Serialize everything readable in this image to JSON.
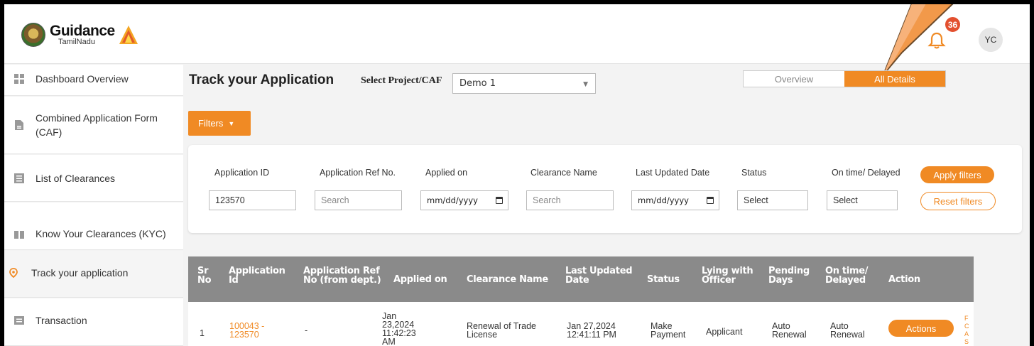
{
  "header": {
    "logo_title": "Guidance",
    "logo_subtitle": "TamilNadu",
    "notification_count": "36",
    "avatar_initials": "YC"
  },
  "sidebar": {
    "items": [
      {
        "label": "Dashboard Overview",
        "icon": "dashboard-icon"
      },
      {
        "label": "Combined Application Form (CAF)",
        "icon": "document-icon"
      },
      {
        "label": "List of Clearances",
        "icon": "list-icon"
      },
      {
        "label": "Know Your Clearances (KYC)",
        "icon": "book-icon"
      },
      {
        "label": "Track your application",
        "icon": "location-pin-icon",
        "active": true
      },
      {
        "label": "Transaction",
        "icon": "transaction-icon"
      }
    ]
  },
  "main": {
    "title": "Track your Application",
    "project_label": "Select Project/CAF",
    "project_value": "Demo 1",
    "tabs": {
      "overview": "Overview",
      "all_details": "All Details",
      "selected": "All Details"
    },
    "filters_button": "Filters"
  },
  "filters": {
    "application_id": {
      "label": "Application ID",
      "value": "123570"
    },
    "ref_no": {
      "label": "Application Ref No.",
      "placeholder": "Search"
    },
    "applied_on": {
      "label": "Applied on",
      "value": "mm/dd/yyyy"
    },
    "clearance_name": {
      "label": "Clearance Name",
      "placeholder": "Search"
    },
    "last_updated": {
      "label": "Last Updated Date",
      "value": "mm/dd/yyyy"
    },
    "status": {
      "label": "Status",
      "value": "Select"
    },
    "ontime": {
      "label": "On time/ Delayed",
      "value": "Select"
    },
    "apply_label": "Apply filters",
    "reset_label": "Reset filters"
  },
  "table": {
    "columns": [
      "Sr No",
      "Application Id",
      "Application Ref No (from dept.)",
      "Applied on",
      "Clearance Name",
      "Last Updated Date",
      "Status",
      "Lying with Officer",
      "Pending Days",
      "On time/ Delayed",
      "Action"
    ],
    "rows": [
      {
        "sr": "1",
        "app_id": "100043 - 123570",
        "ref_no": "-",
        "applied_on": "Jan 23,2024 11:42:23 AM",
        "clearance": "Renewal of Trade License",
        "last_updated": "Jan 27,2024 12:41:11 PM",
        "status": "Make Payment",
        "lying_with": "Applicant",
        "pending": "Auto Renewal",
        "ontime": "Auto Renewal",
        "action": "Actions"
      }
    ]
  },
  "colors": {
    "accent": "#f08a24",
    "header_gray": "#8a8a8a",
    "badge": "#e3502f"
  }
}
